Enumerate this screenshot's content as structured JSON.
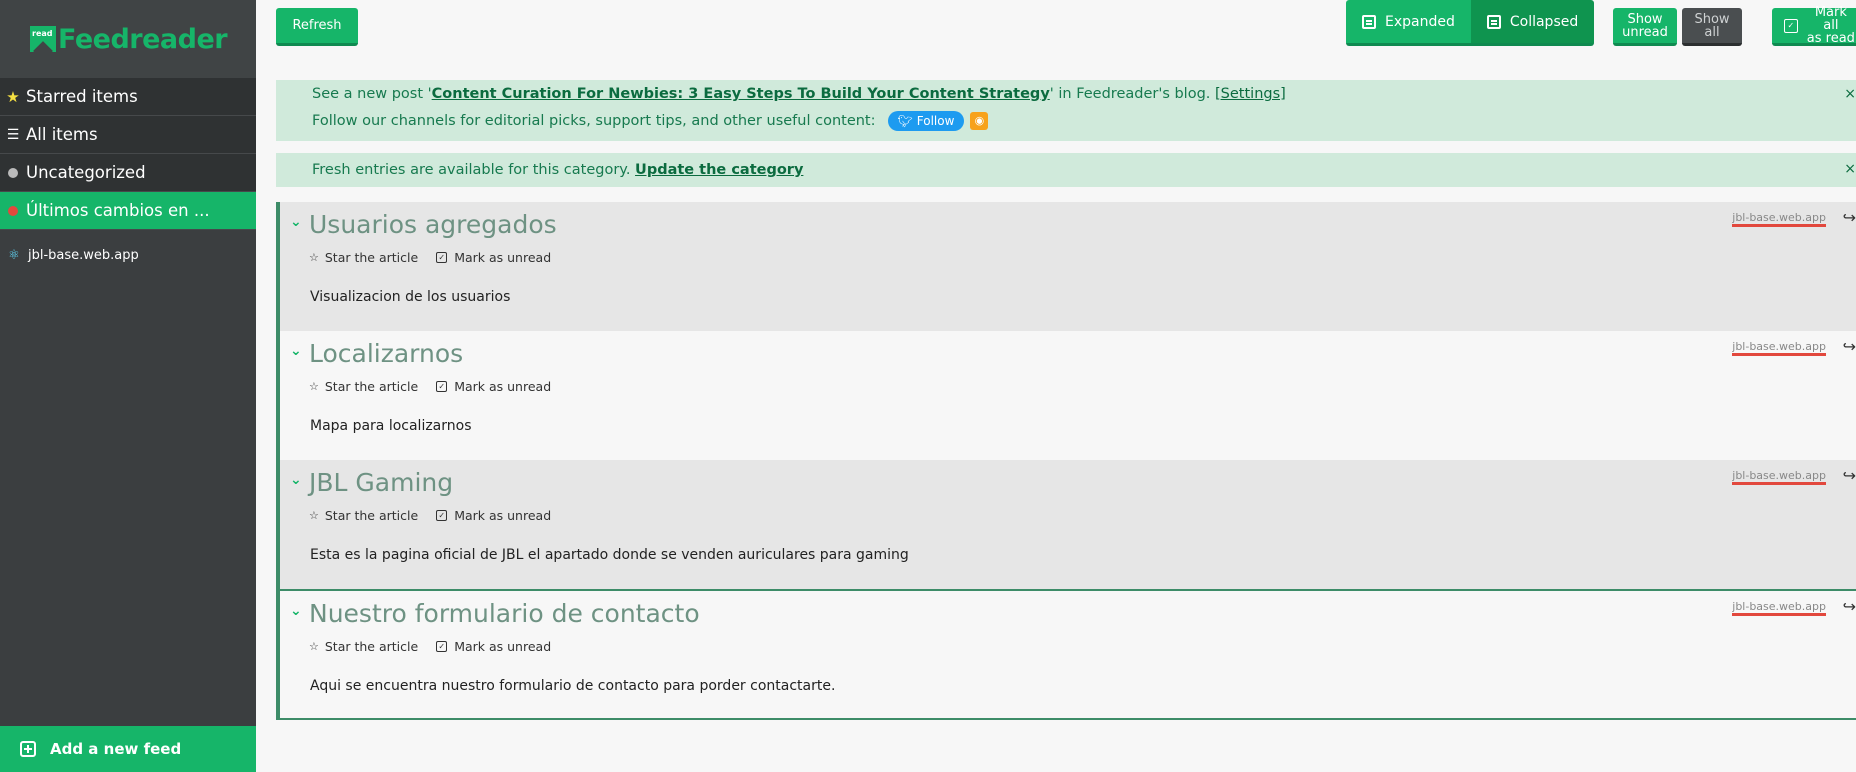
{
  "app": {
    "logo_badge": "read",
    "logo_text": "Feedreader"
  },
  "sidebar": {
    "items": [
      {
        "label": "Starred items",
        "icon": "star-icon"
      },
      {
        "label": "All items",
        "icon": "list-icon"
      },
      {
        "label": "Uncategorized",
        "icon": "grey-dot-icon"
      },
      {
        "label": "Últimos cambios en ...",
        "icon": "red-dot-icon"
      }
    ],
    "feed": {
      "label": "jbl-base.web.app",
      "icon": "react-icon"
    },
    "add_feed": "Add a new feed"
  },
  "toolbar": {
    "refresh": "Refresh",
    "expanded": "Expanded",
    "collapsed": "Collapsed",
    "show_unread_1": "Show",
    "show_unread_2": "unread",
    "show_all_1": "Show",
    "show_all_2": "all",
    "mark_all_1": "Mark all",
    "mark_all_2": "as read"
  },
  "notice1": {
    "pre": "See a new post '",
    "link": "Content Curation For Newbies: 3 Easy Steps To Build Your Content Strategy",
    "post": "' in Feedreader's blog.",
    "settings": "[Settings]",
    "follow_text": "Follow our channels for editorial picks, support tips, and other useful content:",
    "follow_btn": "Follow",
    "close": "×"
  },
  "notice2": {
    "text": "Fresh entries are available for this category.",
    "link": "Update the category",
    "close": "×"
  },
  "article_actions": {
    "star": "Star the article",
    "unread": "Mark as unread"
  },
  "articles": [
    {
      "title": "Usuarios agregados",
      "desc": "Visualizacion de los usuarios",
      "source": "jbl-base.web.app"
    },
    {
      "title": "Localizarnos",
      "desc": "Mapa para localizarnos",
      "source": "jbl-base.web.app"
    },
    {
      "title": "JBL Gaming",
      "desc": "Esta es la pagina oficial de JBL el apartado donde se venden auriculares para gaming",
      "source": "jbl-base.web.app"
    },
    {
      "title": "Nuestro formulario de contacto",
      "desc": "Aqui se encuentra nuestro formulario de contacto para porder contactarte.",
      "source": "jbl-base.web.app"
    }
  ],
  "colors": {
    "accent": "#16b569",
    "sidebar": "#3b3e40",
    "notice_bg": "#d0eadb",
    "source_underline": "#e2483d"
  }
}
